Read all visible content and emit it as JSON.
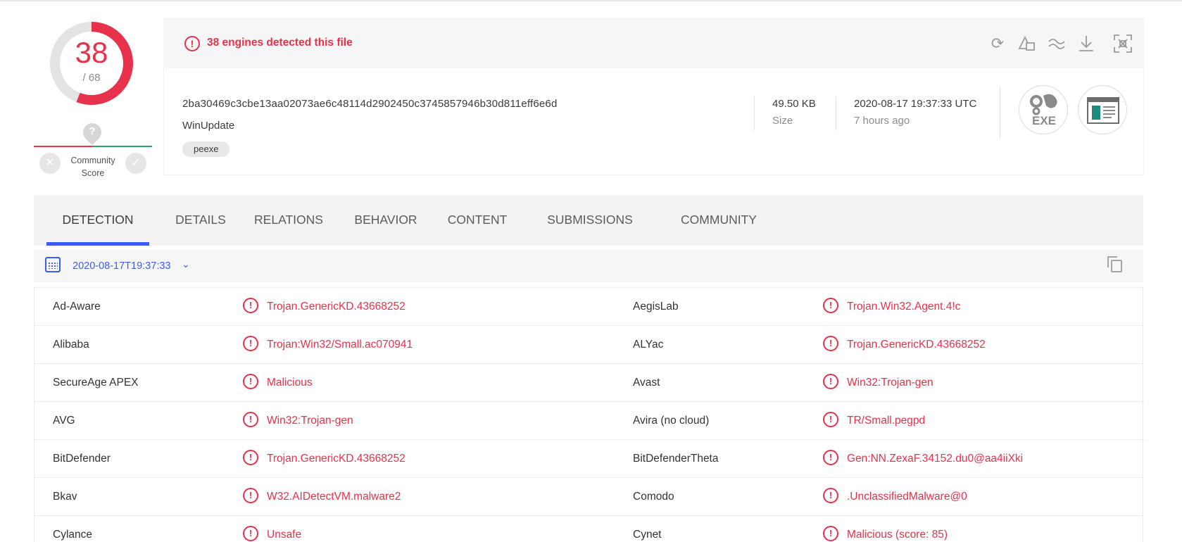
{
  "score": {
    "detected": "38",
    "total": "/ 68",
    "detected_fraction": 0.5588
  },
  "community": {
    "label": "Community Score",
    "question": "?"
  },
  "alert": {
    "text": "38 engines detected this file"
  },
  "file": {
    "hash": "2ba30469c3cbe13aa02073ae6c48114d2902450c3745857946b30d811eff6e6d",
    "name": "WinUpdate",
    "tag": "peexe",
    "size_value": "49.50 KB",
    "size_label": "Size",
    "date_value": "2020-08-17 19:37:33 UTC",
    "date_label": "7 hours ago",
    "type_icon_label": "EXE"
  },
  "tabs": [
    "DETECTION",
    "DETAILS",
    "RELATIONS",
    "BEHAVIOR",
    "CONTENT",
    "SUBMISSIONS",
    "COMMUNITY"
  ],
  "datebar": {
    "date": "2020-08-17T19:37:33"
  },
  "detections": [
    {
      "left_engine": "Ad-Aware",
      "left_result": "Trojan.GenericKD.43668252",
      "right_engine": "AegisLab",
      "right_result": "Trojan.Win32.Agent.4!c"
    },
    {
      "left_engine": "Alibaba",
      "left_result": "Trojan:Win32/Small.ac070941",
      "right_engine": "ALYac",
      "right_result": "Trojan.GenericKD.43668252"
    },
    {
      "left_engine": "SecureAge APEX",
      "left_result": "Malicious",
      "right_engine": "Avast",
      "right_result": "Win32:Trojan-gen"
    },
    {
      "left_engine": "AVG",
      "left_result": "Win32:Trojan-gen",
      "right_engine": "Avira (no cloud)",
      "right_result": "TR/Small.pegpd"
    },
    {
      "left_engine": "BitDefender",
      "left_result": "Trojan.GenericKD.43668252",
      "right_engine": "BitDefenderTheta",
      "right_result": "Gen:NN.ZexaF.34152.du0@aa4iiXki"
    },
    {
      "left_engine": "Bkav",
      "left_result": "W32.AIDetectVM.malware2",
      "right_engine": "Comodo",
      "right_result": ".UnclassifiedMalware@0"
    },
    {
      "left_engine": "Cylance",
      "left_result": "Unsafe",
      "right_engine": "Cynet",
      "right_result": "Malicious (score: 85)"
    }
  ],
  "colors": {
    "malicious": "#e8314a",
    "accent": "#3d5cf5",
    "harmless": "#2aa26b"
  },
  "icons": [
    "alert-icon",
    "reanalyze-icon",
    "similar-icon",
    "graph-icon",
    "download-icon",
    "fullscreen-icon",
    "calendar-icon",
    "chevron-down-icon",
    "copy-icon",
    "exe-gears-icon",
    "window-icon"
  ]
}
